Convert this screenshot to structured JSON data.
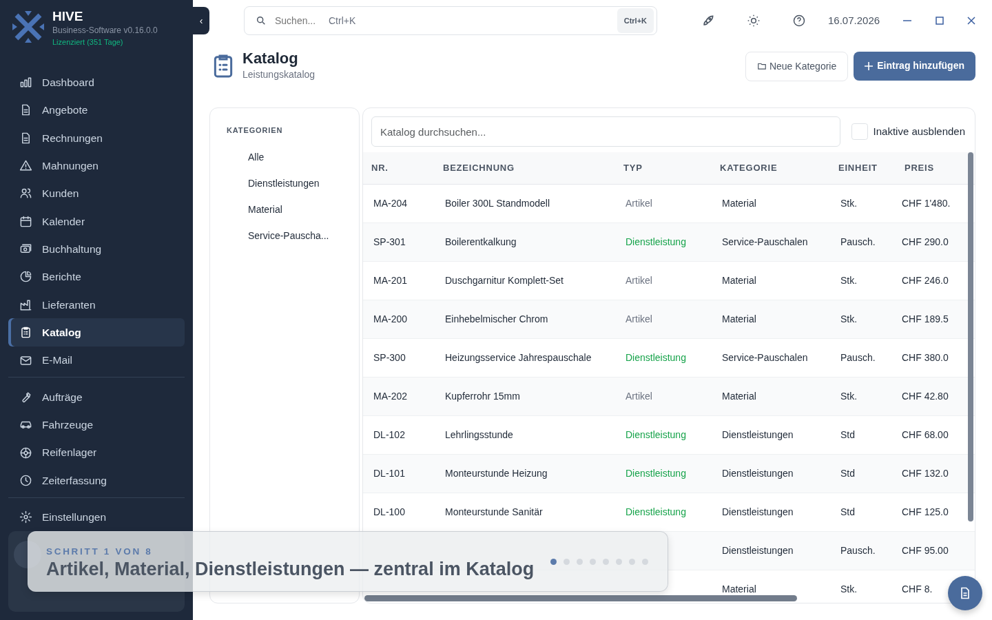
{
  "app": {
    "name": "HIVE",
    "version": "Business-Software v0.16.0.0",
    "license": "Lizenziert (351 Tage)"
  },
  "sidebar": {
    "sections": [
      [
        {
          "label": "Dashboard",
          "selected": false
        },
        {
          "label": "Angebote",
          "selected": false
        },
        {
          "label": "Rechnungen",
          "selected": false
        },
        {
          "label": "Mahnungen",
          "selected": false
        },
        {
          "label": "Kunden",
          "selected": false
        },
        {
          "label": "Kalender",
          "selected": false
        },
        {
          "label": "Buchhaltung",
          "selected": false
        },
        {
          "label": "Berichte",
          "selected": false
        },
        {
          "label": "Lieferanten",
          "selected": false
        },
        {
          "label": "Katalog",
          "selected": true
        },
        {
          "label": "E-Mail",
          "selected": false
        }
      ],
      [
        {
          "label": "Aufträge",
          "selected": false
        },
        {
          "label": "Fahrzeuge",
          "selected": false
        },
        {
          "label": "Reifenlager",
          "selected": false
        },
        {
          "label": "Zeiterfassung",
          "selected": false
        }
      ],
      [
        {
          "label": "Einstellungen",
          "selected": false
        }
      ]
    ],
    "collapse": "‹"
  },
  "topbar": {
    "search": {
      "placeholder": "Suchen...",
      "hint": "Ctrl+K",
      "shortcut": "Ctrl+K"
    },
    "date": "16.07.2026"
  },
  "page": {
    "title": "Katalog",
    "subtitle": "Leistungskatalog",
    "buttons": [
      {
        "label": "Neue Kategorie",
        "kind": "secondary"
      },
      {
        "label": "Eintrag hinzufügen",
        "kind": "primary"
      }
    ]
  },
  "categories": {
    "heading": "KATEGORIEN",
    "items": [
      {
        "label": "Alle",
        "selected": false
      },
      {
        "label": "Dienstleistungen",
        "selected": false
      },
      {
        "label": "Material",
        "selected": false
      },
      {
        "label": "Service-Pauscha...",
        "selected": false
      }
    ]
  },
  "catalog": {
    "search": {
      "placeholder": "Katalog durchsuchen..."
    },
    "hide_inactive": {
      "label": "Inaktive ausblenden",
      "checked": false
    },
    "columns": [
      "NR.",
      "BEZEICHNUNG",
      "TYP",
      "KATEGORIE",
      "EINHEIT",
      "PREIS"
    ],
    "rows": [
      {
        "nr": "MA-204",
        "name": "Boiler 300L Standmodell",
        "type": "Artikel",
        "kind": "article",
        "category": "Material",
        "unit": "Stk.",
        "price": "CHF 1'480."
      },
      {
        "nr": "SP-301",
        "name": "Boilerentkalkung",
        "type": "Dienstleistung",
        "kind": "service",
        "category": "Service-Pauschalen",
        "unit": "Pausch.",
        "price": "CHF 290.0"
      },
      {
        "nr": "MA-201",
        "name": "Duschgarnitur Komplett-Set",
        "type": "Artikel",
        "kind": "article",
        "category": "Material",
        "unit": "Stk.",
        "price": "CHF 246.0"
      },
      {
        "nr": "MA-200",
        "name": "Einhebelmischer Chrom",
        "type": "Artikel",
        "kind": "article",
        "category": "Material",
        "unit": "Stk.",
        "price": "CHF 189.5"
      },
      {
        "nr": "SP-300",
        "name": "Heizungsservice Jahrespauschale",
        "type": "Dienstleistung",
        "kind": "service",
        "category": "Service-Pauschalen",
        "unit": "Pausch.",
        "price": "CHF 380.0"
      },
      {
        "nr": "MA-202",
        "name": "Kupferrohr 15mm",
        "type": "Artikel",
        "kind": "article",
        "category": "Material",
        "unit": "Stk.",
        "price": "CHF 42.80"
      },
      {
        "nr": "DL-102",
        "name": "Lehrlingsstunde",
        "type": "Dienstleistung",
        "kind": "service",
        "category": "Dienstleistungen",
        "unit": "Std",
        "price": "CHF 68.00"
      },
      {
        "nr": "DL-101",
        "name": "Monteurstunde Heizung",
        "type": "Dienstleistung",
        "kind": "service",
        "category": "Dienstleistungen",
        "unit": "Std",
        "price": "CHF 132.0"
      },
      {
        "nr": "DL-100",
        "name": "Monteurstunde Sanitär",
        "type": "Dienstleistung",
        "kind": "service",
        "category": "Dienstleistungen",
        "unit": "Std",
        "price": "CHF 125.0"
      },
      {
        "category": "Dienstleistungen",
        "unit": "Pausch.",
        "price": "CHF 95.00"
      },
      {
        "category": "Material",
        "unit": "Stk.",
        "price": "CHF 8."
      }
    ]
  },
  "tour": {
    "step": "SCHRITT 1 VON 8",
    "title": "Artikel, Material, Dienstleistungen — zentral im Katalog",
    "dots": [
      {
        "selected": true
      },
      {
        "selected": false
      },
      {
        "selected": false
      },
      {
        "selected": false
      },
      {
        "selected": false
      },
      {
        "selected": false
      },
      {
        "selected": false
      },
      {
        "selected": false
      }
    ]
  }
}
